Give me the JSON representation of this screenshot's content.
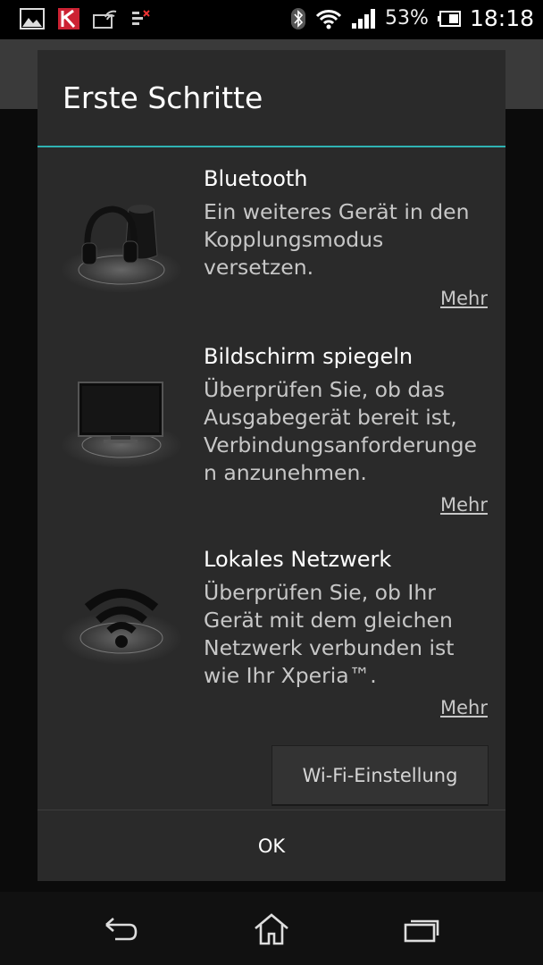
{
  "status_bar": {
    "battery_percent": "53%",
    "time": "18:18",
    "left_icons": [
      "gallery-icon",
      "kaspersky-icon",
      "wifi-screen-icon",
      "data-transfer-icon"
    ],
    "right_icons": [
      "bluetooth-icon",
      "wifi-signal-icon",
      "cell-signal-icon",
      "battery-icon"
    ]
  },
  "dialog": {
    "title": "Erste Schritte",
    "items": [
      {
        "title": "Bluetooth",
        "description": "Ein weiteres Gerät in den Kopplungsmodus versetzen.",
        "more_label": "Mehr",
        "image": "headphones-speaker-icon"
      },
      {
        "title": "Bildschirm spiegeln",
        "description": "Überprüfen Sie, ob das Ausgabegerät bereit ist, Verbindungsanforderunge n anzunehmen.",
        "more_label": "Mehr",
        "image": "tv-icon"
      },
      {
        "title": "Lokales Netzwerk",
        "description": "Überprüfen Sie, ob Ihr Gerät mit dem gleichen Netzwerk verbunden ist wie Ihr Xperia™.",
        "more_label": "Mehr",
        "image": "wifi-network-icon"
      }
    ],
    "wifi_settings_label": "Wi-Fi-Einstellung",
    "ok_label": "OK"
  },
  "nav_bar": {
    "buttons": [
      "back-icon",
      "home-icon",
      "recent-apps-icon"
    ]
  },
  "colors": {
    "accent": "#2fb3b3",
    "dialog_bg": "#2a2a2a"
  }
}
